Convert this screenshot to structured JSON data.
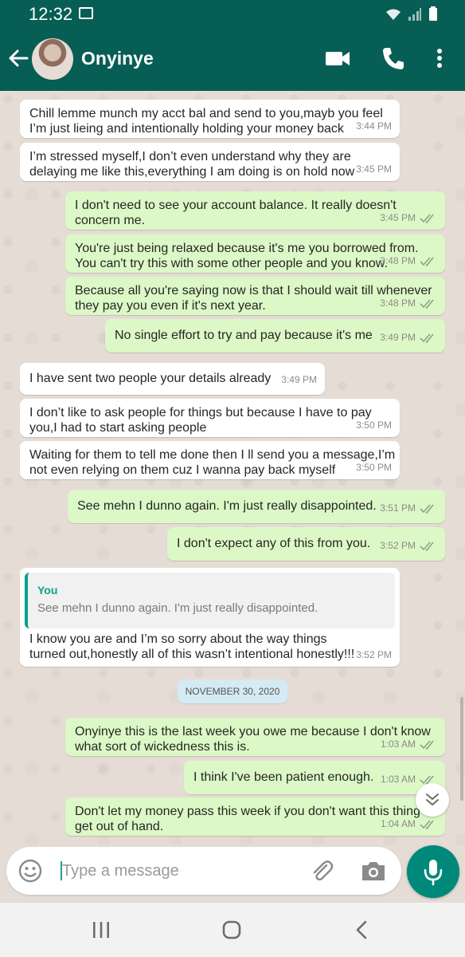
{
  "status_bar": {
    "time": "12:32"
  },
  "header": {
    "contact_name": "Onyinye"
  },
  "messages": [
    {
      "dir": "in",
      "text": "Chill lemme munch my acct bal and send to you,mayb you feel I’m just lieing and intentionally holding your money back",
      "time": "3:44 PM"
    },
    {
      "dir": "in",
      "text": "I’m stressed myself,I don’t even understand why they are delaying me like this,everything I am doing is on hold now",
      "time": "3:45 PM"
    },
    {
      "dir": "out",
      "text": "I don't need to see your account balance. It really doesn't concern me.",
      "time": "3:45 PM",
      "status": "read"
    },
    {
      "dir": "out",
      "text": "You're just being relaxed because it's me you borrowed from. You can't try this with some other people and you know.",
      "time": "3:48 PM",
      "status": "read"
    },
    {
      "dir": "out",
      "text": "Because all you're saying now is that I should wait till whenever they pay you even if it's next year.",
      "time": "3:48 PM",
      "status": "read"
    },
    {
      "dir": "out",
      "text": "No single effort to try and pay because it's me",
      "time": "3:49 PM",
      "status": "read"
    },
    {
      "dir": "in",
      "text": "I have sent two people your details already",
      "time": "3:49 PM"
    },
    {
      "dir": "in",
      "text": "I don’t like to ask people for things but because I have to pay you,I had to start asking people",
      "time": "3:50 PM"
    },
    {
      "dir": "in",
      "text": "Waiting for them to tell me done then I ll send you a message,I’m not even relying on them cuz I wanna pay back myself",
      "time": "3:50 PM"
    },
    {
      "dir": "out",
      "text": "See mehn I dunno again. I'm just really disappointed.",
      "time": "3:51 PM",
      "status": "read"
    },
    {
      "dir": "out",
      "text": "I don't expect any of this from you.",
      "time": "3:52 PM",
      "status": "read"
    },
    {
      "dir": "in",
      "quote_author": "You",
      "quote_text": "See mehn I dunno again. I'm just really disappointed.",
      "text": "I know you are and I’m so sorry about the way things turned out,honestly all of this wasn’t intentional honestly!!!",
      "time": "3:52 PM"
    },
    {
      "dir": "out",
      "text": "Onyinye this is the last week you owe me because I don't know what sort of wickedness this is.",
      "time": "1:03 AM",
      "status": "read"
    },
    {
      "dir": "out",
      "text": "I think I've been patient enough.",
      "time": "1:03 AM",
      "status": "read"
    },
    {
      "dir": "out",
      "text": "Don't let my money pass this week if you don't want this thing to get out of hand.",
      "time": "1:04 AM",
      "status": "read"
    }
  ],
  "date_divider": "NOVEMBER 30, 2020",
  "composer": {
    "placeholder": "Type a message",
    "value": ""
  },
  "colors": {
    "header": "#075e54",
    "outgoing_bubble": "#dcf8c6",
    "incoming_bubble": "#ffffff",
    "accent": "#00897b",
    "chat_bg": "#e5ddd5"
  },
  "icons": [
    "back-arrow-icon",
    "video-call-icon",
    "phone-icon",
    "more-vert-icon",
    "emoji-icon",
    "attach-icon",
    "camera-icon",
    "mic-icon",
    "double-check-icon",
    "scroll-down-icon"
  ]
}
